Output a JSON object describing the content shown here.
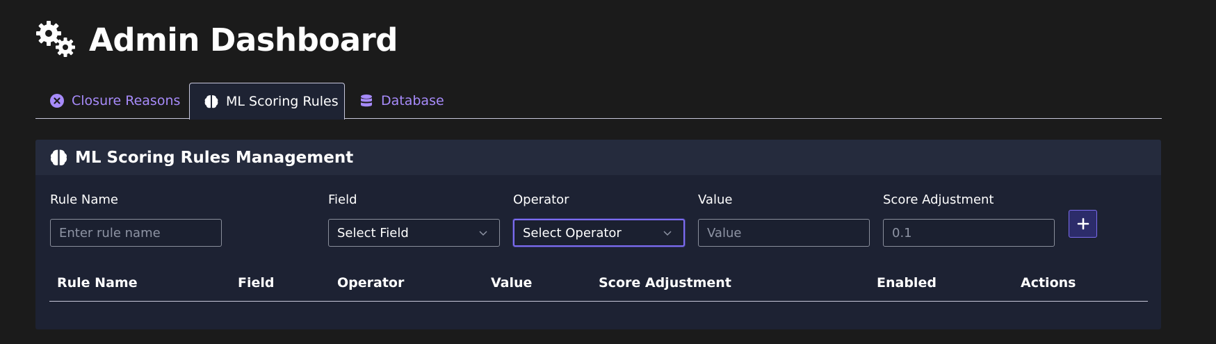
{
  "page": {
    "title": "Admin Dashboard",
    "title_icon": "gears-icon"
  },
  "tabs": [
    {
      "label": "Closure Reasons",
      "icon": "x-circle-icon",
      "active": false
    },
    {
      "label": "ML Scoring Rules",
      "icon": "brain-icon",
      "active": true
    },
    {
      "label": "Database",
      "icon": "database-icon",
      "active": false
    }
  ],
  "card": {
    "title": "ML Scoring Rules Management",
    "icon": "brain-icon"
  },
  "form": {
    "rule_name": {
      "label": "Rule Name",
      "placeholder": "Enter rule name",
      "value": ""
    },
    "field": {
      "label": "Field",
      "value": "Select Field"
    },
    "operator": {
      "label": "Operator",
      "value": "Select Operator"
    },
    "value": {
      "label": "Value",
      "placeholder": "Value",
      "value": ""
    },
    "score_adjustment": {
      "label": "Score Adjustment",
      "placeholder": "0.1",
      "value": ""
    },
    "add_button_icon": "plus-icon"
  },
  "table": {
    "columns": [
      "Rule Name",
      "Field",
      "Operator",
      "Value",
      "Score Adjustment",
      "Enabled",
      "Actions"
    ],
    "rows": []
  },
  "colors": {
    "background": "#1b1b1b",
    "accent": "#a78bfa",
    "focus_border": "#7c6cf0",
    "card_bg": "#1d2233",
    "card_header_bg": "#252b3d"
  }
}
